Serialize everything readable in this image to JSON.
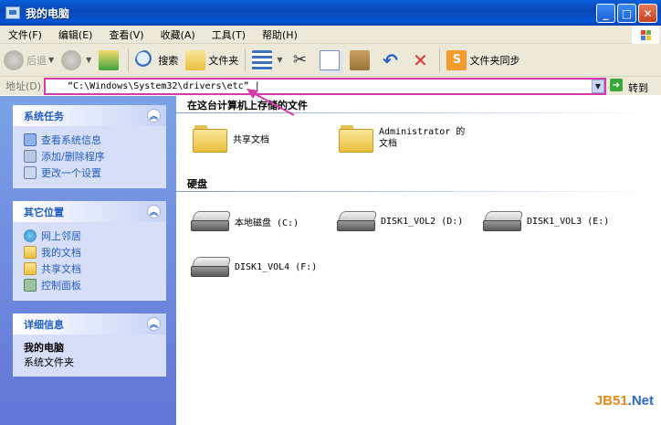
{
  "window": {
    "title": "我的电脑"
  },
  "menu": [
    "文件(F)",
    "编辑(E)",
    "查看(V)",
    "收藏(A)",
    "工具(T)",
    "帮助(H)"
  ],
  "toolbar": {
    "back": "后退",
    "search": "搜索",
    "folders": "文件夹",
    "sync": "文件夹同步"
  },
  "address": {
    "label": "地址(D)",
    "value": "“C:\\Windows\\System32\\drivers\\etc” |",
    "go": "转到"
  },
  "sidebar": {
    "system_tasks": {
      "title": "系统任务",
      "items": [
        "查看系统信息",
        "添加/删除程序",
        "更改一个设置"
      ]
    },
    "other_places": {
      "title": "其它位置",
      "items": [
        "网上邻居",
        "我的文档",
        "共享文档",
        "控制面板"
      ]
    },
    "details": {
      "title": "详细信息",
      "name": "我的电脑",
      "type": "系统文件夹"
    }
  },
  "content": {
    "files_group": "在这台计算机上存储的文件",
    "folders": [
      "共享文档",
      "Administrator 的文档"
    ],
    "drives_group": "硬盘",
    "drives": [
      "本地磁盘 (C:)",
      "DISK1_VOL2 (D:)",
      "DISK1_VOL3 (E:)",
      "DISK1_VOL4 (F:)"
    ]
  },
  "watermark": {
    "a": "JB51",
    "b": ".Net"
  },
  "colors": {
    "annotation": "#d63aa8",
    "title_bar": "#0553d6",
    "sidebar_link": "#215dc6"
  }
}
